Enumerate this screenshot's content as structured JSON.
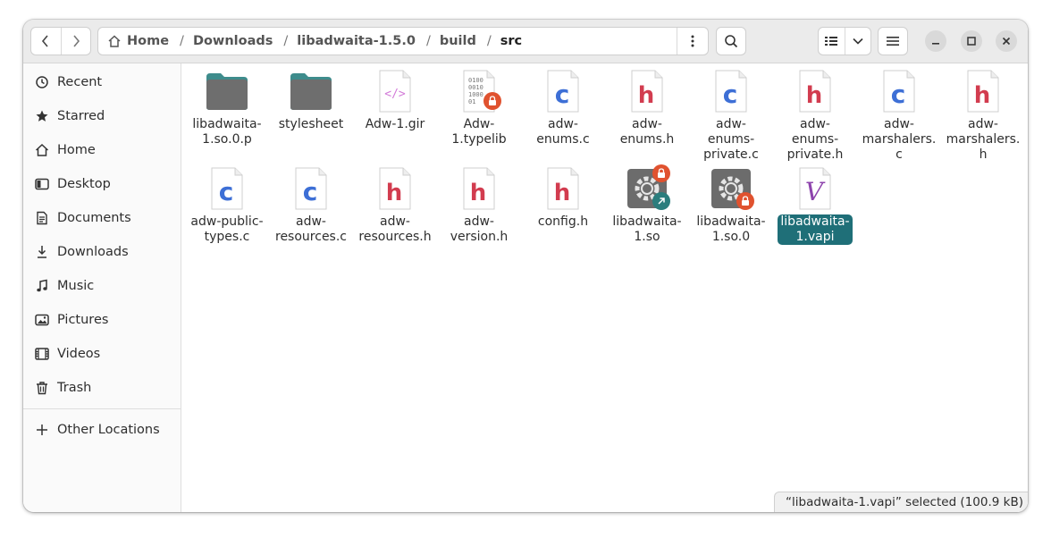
{
  "header": {
    "breadcrumbs": [
      "Home",
      "Downloads",
      "libadwaita-1.5.0",
      "build",
      "src"
    ],
    "separator": "/"
  },
  "sidebar": {
    "items": [
      {
        "label": "Recent",
        "icon": "clock-icon"
      },
      {
        "label": "Starred",
        "icon": "star-icon"
      },
      {
        "label": "Home",
        "icon": "home-icon"
      },
      {
        "label": "Desktop",
        "icon": "desktop-icon"
      },
      {
        "label": "Documents",
        "icon": "document-icon"
      },
      {
        "label": "Downloads",
        "icon": "download-icon"
      },
      {
        "label": "Music",
        "icon": "music-icon"
      },
      {
        "label": "Pictures",
        "icon": "picture-icon"
      },
      {
        "label": "Videos",
        "icon": "video-icon"
      },
      {
        "label": "Trash",
        "icon": "trash-icon"
      }
    ],
    "other_locations": "Other Locations"
  },
  "files": [
    {
      "name": "libadwaita-1.so.0.p",
      "type": "folder"
    },
    {
      "name": "stylesheet",
      "type": "folder"
    },
    {
      "name": "Adw-1.gir",
      "type": "xml"
    },
    {
      "name": "Adw-1.typelib",
      "type": "binary-locked"
    },
    {
      "name": "adw-enums.c",
      "type": "c"
    },
    {
      "name": "adw-enums.h",
      "type": "h"
    },
    {
      "name": "adw-enums-private.c",
      "type": "c"
    },
    {
      "name": "adw-enums-private.h",
      "type": "h"
    },
    {
      "name": "adw-marshalers.c",
      "type": "c"
    },
    {
      "name": "adw-marshalers.h",
      "type": "h"
    },
    {
      "name": "adw-public-types.c",
      "type": "c"
    },
    {
      "name": "adw-resources.c",
      "type": "c"
    },
    {
      "name": "adw-resources.h",
      "type": "h"
    },
    {
      "name": "adw-version.h",
      "type": "h"
    },
    {
      "name": "config.h",
      "type": "h"
    },
    {
      "name": "libadwaita-1.so",
      "type": "lib-link"
    },
    {
      "name": "libadwaita-1.so.0",
      "type": "lib-locked"
    },
    {
      "name": "libadwaita-1.vapi",
      "type": "vapi",
      "selected": true
    }
  ],
  "status": "“libadwaita-1.vapi” selected  (100.9 kB)",
  "colors": {
    "accent": "#1f6f78",
    "c_file": "#3d6fd6",
    "h_file": "#d23c4f",
    "vapi": "#8e44ad",
    "lock": "#e0522f"
  }
}
